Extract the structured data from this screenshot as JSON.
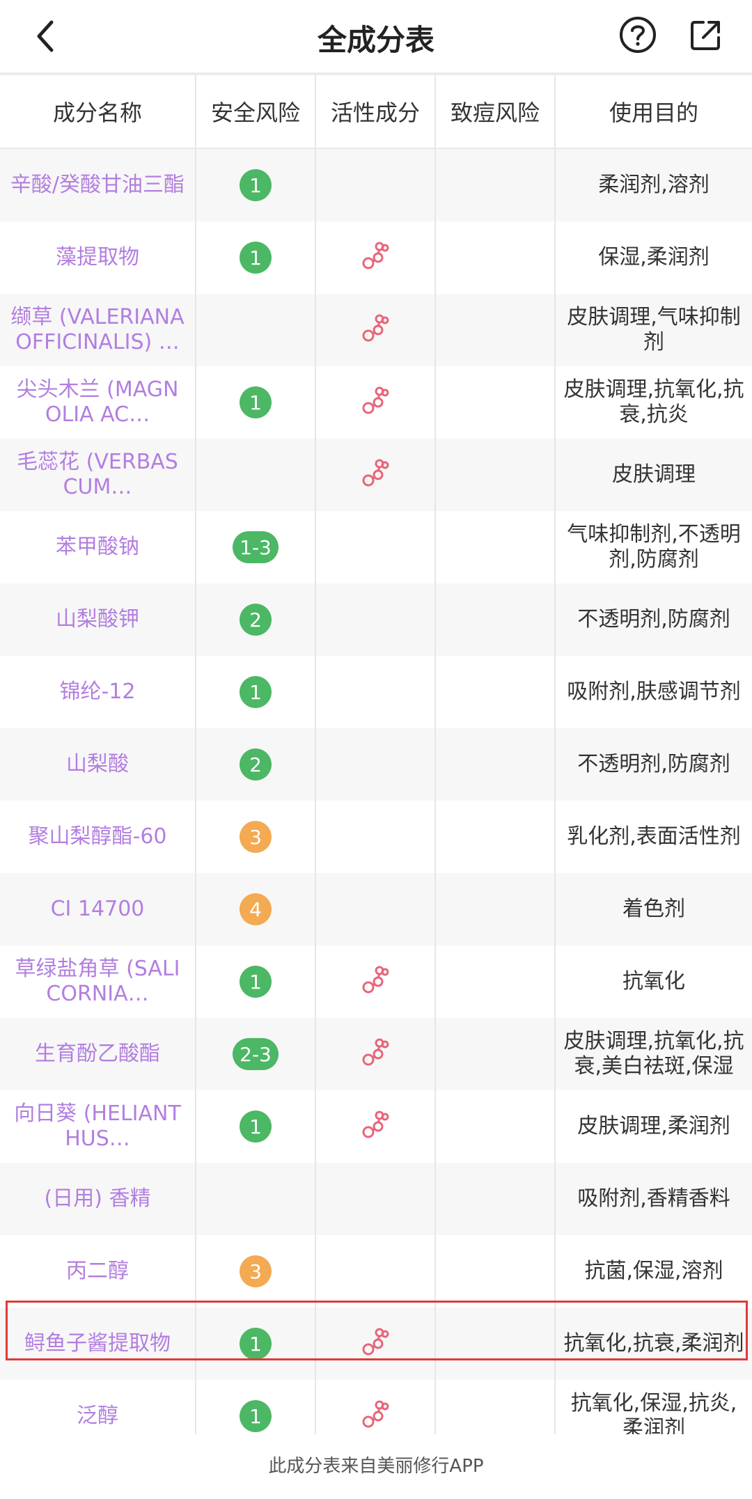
{
  "nav": {
    "title": "全成分表",
    "back_icon": "chevron-left-icon",
    "help_icon": "question-circle-icon",
    "share_icon": "share-icon"
  },
  "columns": [
    "成分名称",
    "安全风险",
    "活性成分",
    "致痘风险",
    "使用目的"
  ],
  "rows": [
    {
      "name": "辛酸/癸酸甘油三酯",
      "risk": "1",
      "risk_color": "green",
      "active": false,
      "purpose": "柔润剂,溶剂"
    },
    {
      "name": "藻提取物",
      "risk": "1",
      "risk_color": "green",
      "active": true,
      "purpose": "保湿,柔润剂"
    },
    {
      "name": "缬草 (VALERIANA OFFICINALIS) …",
      "risk": "",
      "risk_color": "",
      "active": true,
      "purpose": "皮肤调理,气味抑制剂"
    },
    {
      "name": "尖头木兰 (MAGNOLIA AC…",
      "risk": "1",
      "risk_color": "green",
      "active": true,
      "purpose": "皮肤调理,抗氧化,抗衰,抗炎"
    },
    {
      "name": "毛蕊花 (VERBASCUM…",
      "risk": "",
      "risk_color": "",
      "active": true,
      "purpose": "皮肤调理"
    },
    {
      "name": "苯甲酸钠",
      "risk": "1-3",
      "risk_color": "green",
      "active": false,
      "purpose": "气味抑制剂,不透明剂,防腐剂"
    },
    {
      "name": "山梨酸钾",
      "risk": "2",
      "risk_color": "green",
      "active": false,
      "purpose": "不透明剂,防腐剂"
    },
    {
      "name": "锦纶-12",
      "risk": "1",
      "risk_color": "green",
      "active": false,
      "purpose": "吸附剂,肤感调节剂"
    },
    {
      "name": "山梨酸",
      "risk": "2",
      "risk_color": "green",
      "active": false,
      "purpose": "不透明剂,防腐剂"
    },
    {
      "name": "聚山梨醇酯-60",
      "risk": "3",
      "risk_color": "orange",
      "active": false,
      "purpose": "乳化剂,表面活性剂"
    },
    {
      "name": "CI 14700",
      "risk": "4",
      "risk_color": "orange",
      "active": false,
      "purpose": "着色剂"
    },
    {
      "name": "草绿盐角草 (SALICORNIA…",
      "risk": "1",
      "risk_color": "green",
      "active": true,
      "purpose": "抗氧化"
    },
    {
      "name": "生育酚乙酸酯",
      "risk": "2-3",
      "risk_color": "green",
      "active": true,
      "purpose": "皮肤调理,抗氧化,抗衰,美白祛斑,保湿"
    },
    {
      "name": "向日葵 (HELIANTHUS…",
      "risk": "1",
      "risk_color": "green",
      "active": true,
      "purpose": "皮肤调理,柔润剂"
    },
    {
      "name": "(日用) 香精",
      "risk": "",
      "risk_color": "",
      "active": false,
      "purpose": "吸附剂,香精香料"
    },
    {
      "name": "丙二醇",
      "risk": "3",
      "risk_color": "orange",
      "active": false,
      "purpose": "抗菌,保湿,溶剂"
    },
    {
      "name": "鲟鱼子酱提取物",
      "risk": "1",
      "risk_color": "green",
      "active": true,
      "purpose": "抗氧化,抗衰,柔润剂"
    },
    {
      "name": "泛醇",
      "risk": "1",
      "risk_color": "green",
      "active": true,
      "purpose": "抗氧化,保湿,抗炎,柔润剂"
    }
  ],
  "footer": {
    "text": "此成分表来自美丽修行APP"
  },
  "colors": {
    "name_purple": "#b27ee0",
    "risk_green": "#4cb764",
    "risk_orange": "#f3aa52",
    "active_pink": "#e8657a",
    "highlight_red": "#e03a3a"
  }
}
